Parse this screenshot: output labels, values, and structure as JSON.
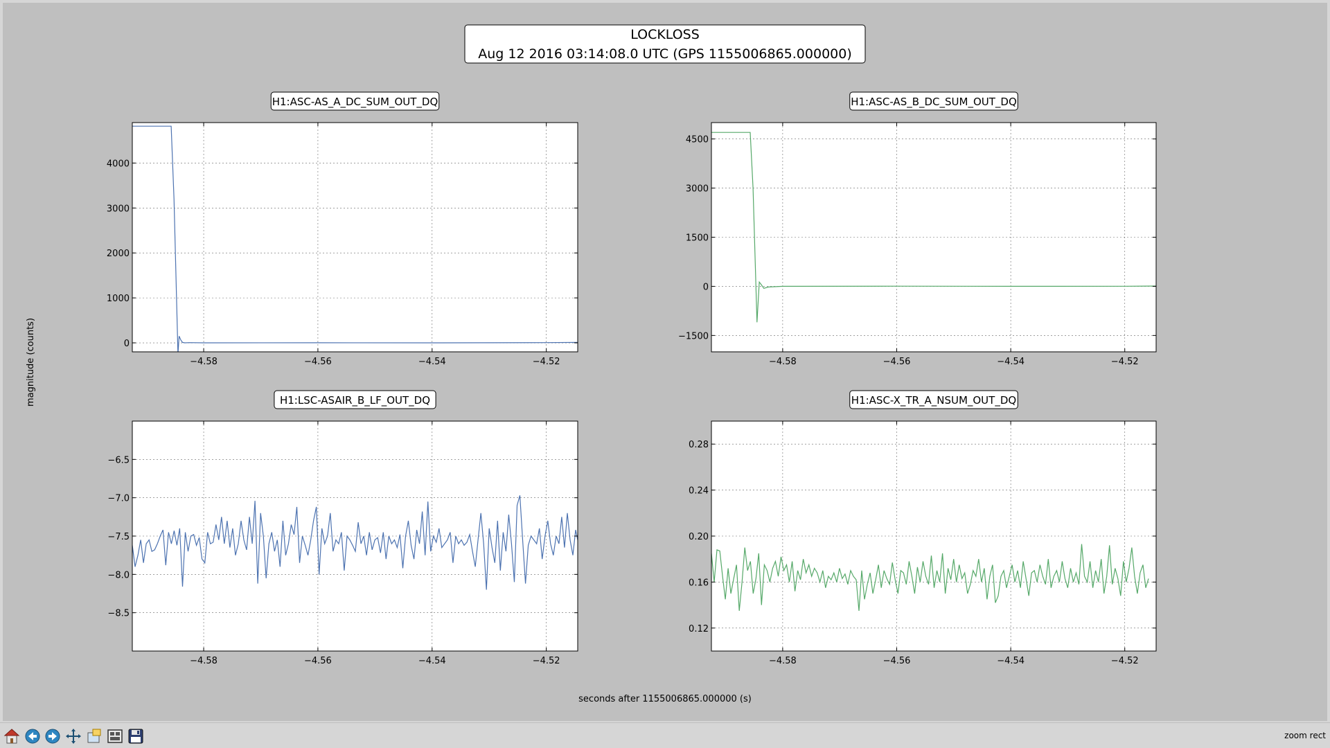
{
  "title": "LOCKLOSS",
  "subtitle": "Aug 12 2016 03:14:08.0 UTC (GPS 1155006865.000000)",
  "xlabel": "seconds after 1155006865.000000 (s)",
  "ylabel": "magnitude (counts)",
  "status_text": "zoom rect",
  "toolbar": [
    {
      "name": "home-button",
      "icon": "home-icon"
    },
    {
      "name": "back-button",
      "icon": "back-arrow-icon"
    },
    {
      "name": "forward-button",
      "icon": "forward-arrow-icon"
    },
    {
      "name": "pan-button",
      "icon": "move-icon"
    },
    {
      "name": "zoom-button",
      "icon": "zoom-rect-icon"
    },
    {
      "name": "subplots-button",
      "icon": "subplots-icon"
    },
    {
      "name": "save-button",
      "icon": "floppy-disk-icon"
    }
  ],
  "colors": {
    "blue": "#4c72b0",
    "green": "#55a868",
    "figure_bg": "#bfbfbf"
  },
  "chart_data": [
    {
      "type": "line",
      "title": "H1:ASC-AS_A_DC_SUM_OUT_DQ",
      "color": "#4c72b0",
      "xlim": [
        -4.5925,
        -4.5145
      ],
      "ylim": [
        -200,
        4900
      ],
      "xticks": [
        -4.58,
        -4.56,
        -4.54,
        -4.52
      ],
      "xtick_labels": [
        "−4.58",
        "−4.56",
        "−4.54",
        "−4.52"
      ],
      "yticks": [
        0,
        1000,
        2000,
        3000,
        4000
      ],
      "ytick_labels": [
        "0",
        "1000",
        "2000",
        "3000",
        "4000"
      ],
      "grid": true,
      "x": [
        -4.5925,
        -4.5857,
        -4.5852,
        -4.5845,
        -4.5843,
        -4.584,
        -4.5837,
        -4.5833,
        -4.5825,
        -4.58,
        -4.56,
        -4.54,
        -4.52,
        -4.5145
      ],
      "y": [
        4820,
        4820,
        3200,
        -250,
        150,
        60,
        10,
        0,
        5,
        0,
        2,
        0,
        5,
        10
      ]
    },
    {
      "type": "line",
      "title": "H1:ASC-AS_B_DC_SUM_OUT_DQ",
      "color": "#55a868",
      "xlim": [
        -4.5925,
        -4.5145
      ],
      "ylim": [
        -2000,
        5000
      ],
      "xticks": [
        -4.58,
        -4.56,
        -4.54,
        -4.52
      ],
      "xtick_labels": [
        "−4.58",
        "−4.56",
        "−4.54",
        "−4.52"
      ],
      "yticks": [
        -1500,
        0,
        1500,
        3000,
        4500
      ],
      "ytick_labels": [
        "−1500",
        "0",
        "1500",
        "3000",
        "4500"
      ],
      "grid": true,
      "x": [
        -4.5925,
        -4.5857,
        -4.5852,
        -4.5845,
        -4.5841,
        -4.5837,
        -4.5833,
        -4.5825,
        -4.58,
        -4.56,
        -4.54,
        -4.52,
        -4.5145
      ],
      "y": [
        4700,
        4700,
        3000,
        -1100,
        130,
        40,
        -60,
        -20,
        0,
        5,
        0,
        2,
        10
      ]
    },
    {
      "type": "line",
      "title": "H1:LSC-ASAIR_B_LF_OUT_DQ",
      "color": "#4c72b0",
      "xlim": [
        -4.5925,
        -4.5145
      ],
      "ylim": [
        -9.0,
        -6.0
      ],
      "xticks": [
        -4.58,
        -4.56,
        -4.54,
        -4.52
      ],
      "xtick_labels": [
        "−4.58",
        "−4.56",
        "−4.54",
        "−4.52"
      ],
      "yticks": [
        -8.5,
        -8.0,
        -7.5,
        -7.0,
        -6.5
      ],
      "ytick_labels": [
        "−8.5",
        "−8.0",
        "−7.5",
        "−7.0",
        "−6.5"
      ],
      "grid": true,
      "x_start": -4.5925,
      "x_step": 0.0004883,
      "y": [
        -7.62,
        -7.9,
        -7.75,
        -7.55,
        -7.85,
        -7.6,
        -7.55,
        -7.7,
        -7.68,
        -7.6,
        -7.5,
        -7.42,
        -7.88,
        -7.45,
        -7.6,
        -7.43,
        -7.62,
        -7.4,
        -8.16,
        -7.45,
        -7.7,
        -7.5,
        -7.48,
        -7.62,
        -7.52,
        -7.8,
        -7.85,
        -7.45,
        -7.6,
        -7.58,
        -7.35,
        -7.55,
        -7.25,
        -7.6,
        -7.3,
        -7.65,
        -7.4,
        -7.75,
        -7.6,
        -7.3,
        -7.55,
        -7.68,
        -7.25,
        -7.6,
        -7.04,
        -8.12,
        -7.2,
        -7.5,
        -8.05,
        -7.6,
        -7.45,
        -7.7,
        -7.55,
        -7.9,
        -7.3,
        -7.75,
        -7.6,
        -7.35,
        -7.48,
        -7.12,
        -7.85,
        -7.5,
        -7.62,
        -7.75,
        -7.55,
        -7.3,
        -7.12,
        -8.0,
        -7.4,
        -7.6,
        -7.5,
        -7.2,
        -7.7,
        -7.55,
        -7.6,
        -7.45,
        -7.95,
        -7.5,
        -7.55,
        -7.62,
        -7.7,
        -7.32,
        -7.6,
        -7.5,
        -7.75,
        -7.45,
        -7.68,
        -7.55,
        -7.52,
        -7.72,
        -7.45,
        -7.8,
        -7.5,
        -7.6,
        -7.55,
        -7.65,
        -7.48,
        -7.92,
        -7.5,
        -7.3,
        -7.62,
        -7.8,
        -7.42,
        -7.6,
        -7.18,
        -7.75,
        -7.05,
        -7.7,
        -7.5,
        -7.58,
        -7.4,
        -7.65,
        -7.6,
        -7.55,
        -7.45,
        -7.85,
        -7.5,
        -7.6,
        -7.55,
        -7.62,
        -7.58,
        -7.48,
        -7.7,
        -7.9,
        -7.55,
        -7.2,
        -7.6,
        -8.2,
        -7.4,
        -7.65,
        -7.85,
        -7.3,
        -7.95,
        -7.45,
        -7.7,
        -7.22,
        -7.6,
        -8.1,
        -7.1,
        -6.97,
        -7.55,
        -8.12,
        -7.62,
        -7.5,
        -7.55,
        -7.6,
        -7.4,
        -7.8,
        -7.5,
        -7.3,
        -7.6,
        -7.75,
        -7.5,
        -7.6,
        -7.25,
        -7.65,
        -7.2,
        -7.55,
        -7.75,
        -7.42,
        -7.6,
        -7.45,
        -7.8,
        -7.5,
        -7.65,
        -7.25,
        -8.05,
        -7.5,
        -7.4,
        -7.6,
        -7.55,
        -7.85,
        -7.5,
        -7.6,
        -7.65,
        -7.55,
        -7.62,
        -7.85,
        -7.45,
        -7.6,
        -7.55,
        -7.75,
        -7.6,
        -7.58,
        -7.9,
        -7.6,
        -7.55,
        -7.62
      ]
    },
    {
      "type": "line",
      "title": "H1:ASC-X_TR_A_NSUM_OUT_DQ",
      "color": "#55a868",
      "xlim": [
        -4.5925,
        -4.5145
      ],
      "ylim": [
        0.1,
        0.3
      ],
      "xticks": [
        -4.58,
        -4.56,
        -4.54,
        -4.52
      ],
      "xtick_labels": [
        "−4.58",
        "−4.56",
        "−4.54",
        "−4.52"
      ],
      "yticks": [
        0.12,
        0.16,
        0.2,
        0.24,
        0.28
      ],
      "ytick_labels": [
        "0.12",
        "0.16",
        "0.20",
        "0.24",
        "0.28"
      ],
      "grid": true,
      "x_start": -4.5925,
      "x_step": 0.0004883,
      "y": [
        0.185,
        0.16,
        0.188,
        0.187,
        0.165,
        0.145,
        0.172,
        0.15,
        0.163,
        0.175,
        0.135,
        0.16,
        0.19,
        0.17,
        0.178,
        0.15,
        0.163,
        0.185,
        0.14,
        0.175,
        0.17,
        0.16,
        0.172,
        0.178,
        0.165,
        0.182,
        0.17,
        0.175,
        0.16,
        0.178,
        0.152,
        0.17,
        0.162,
        0.18,
        0.168,
        0.175,
        0.165,
        0.172,
        0.168,
        0.16,
        0.17,
        0.155,
        0.165,
        0.162,
        0.168,
        0.16,
        0.172,
        0.163,
        0.167,
        0.158,
        0.17,
        0.165,
        0.162,
        0.135,
        0.17,
        0.145,
        0.158,
        0.168,
        0.15,
        0.162,
        0.175,
        0.155,
        0.17,
        0.163,
        0.158,
        0.177,
        0.162,
        0.15,
        0.17,
        0.168,
        0.158,
        0.178,
        0.165,
        0.15,
        0.173,
        0.16,
        0.178,
        0.165,
        0.158,
        0.183,
        0.155,
        0.17,
        0.16,
        0.185,
        0.15,
        0.172,
        0.162,
        0.18,
        0.16,
        0.175,
        0.163,
        0.168,
        0.15,
        0.158,
        0.17,
        0.165,
        0.18,
        0.16,
        0.172,
        0.145,
        0.165,
        0.175,
        0.142,
        0.148,
        0.165,
        0.17,
        0.155,
        0.165,
        0.175,
        0.16,
        0.17,
        0.155,
        0.178,
        0.163,
        0.148,
        0.168,
        0.17,
        0.16,
        0.175,
        0.165,
        0.158,
        0.18,
        0.155,
        0.165,
        0.17,
        0.16,
        0.178,
        0.163,
        0.155,
        0.172,
        0.16,
        0.168,
        0.158,
        0.193,
        0.165,
        0.16,
        0.178,
        0.155,
        0.17,
        0.16,
        0.18,
        0.15,
        0.165,
        0.192,
        0.158,
        0.172,
        0.163,
        0.148,
        0.178,
        0.16,
        0.172,
        0.19,
        0.165,
        0.15,
        0.168,
        0.175,
        0.155,
        0.163
      ]
    }
  ]
}
